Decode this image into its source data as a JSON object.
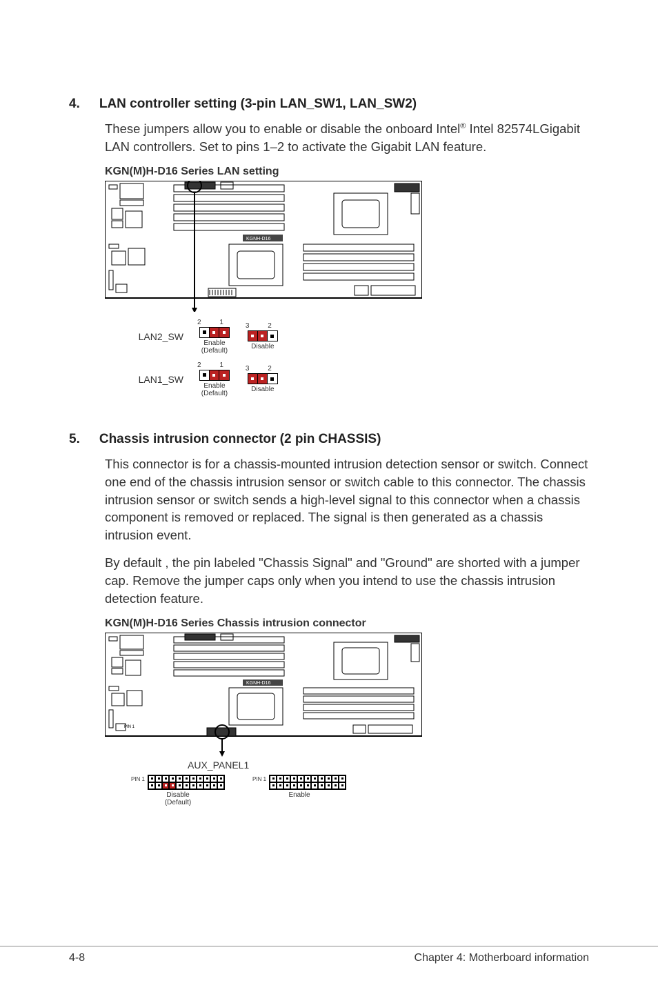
{
  "section4": {
    "num": "4.",
    "title_a": "LAN controller setting (3-pin LAN_SW1, LAN_SW2)",
    "body_a": "These jumpers allow you to enable or disable the onboard Intel",
    "body_sup": "®",
    "body_b": " Intel 82574LGigabit LAN controllers. Set to pins 1–2 to activate the Gigabit LAN feature.",
    "fig_title": "KGN(M)H-D16 Series LAN setting",
    "board_label": "KGNH-D16",
    "lan2_label": "LAN2_SW",
    "lan1_label": "LAN1_SW",
    "nums_enable": "2 1",
    "nums_disable": "3 2",
    "cap_enable": "Enable",
    "cap_default": "(Default)",
    "cap_disable": "Disable"
  },
  "section5": {
    "num": "5.",
    "title": "Chassis intrusion connector (2 pin CHASSIS)",
    "p1": "This connector is for a chassis-mounted intrusion detection sensor or switch. Connect one end of the chassis intrusion sensor or switch cable to this connector. The chassis intrusion sensor or switch sends a high-level signal to this connector when a chassis component is removed or replaced. The signal is then generated as a chassis intrusion event.",
    "p2": "By default , the pin labeled \"Chassis Signal\" and \"Ground\" are shorted with a jumper cap. Remove the jumper caps only when you intend to use the chassis intrusion detection feature.",
    "fig_title": "KGN(M)H-D16 Series Chassis intrusion connector",
    "board_label": "KGNH-D16",
    "aux_label": "AUX_PANEL1",
    "pin1": "PIN 1",
    "cap_disable": "Disable",
    "cap_default": "(Default)",
    "cap_enable": "Enable"
  },
  "footer": {
    "left": "4-8",
    "right": "Chapter 4: Motherboard information"
  }
}
